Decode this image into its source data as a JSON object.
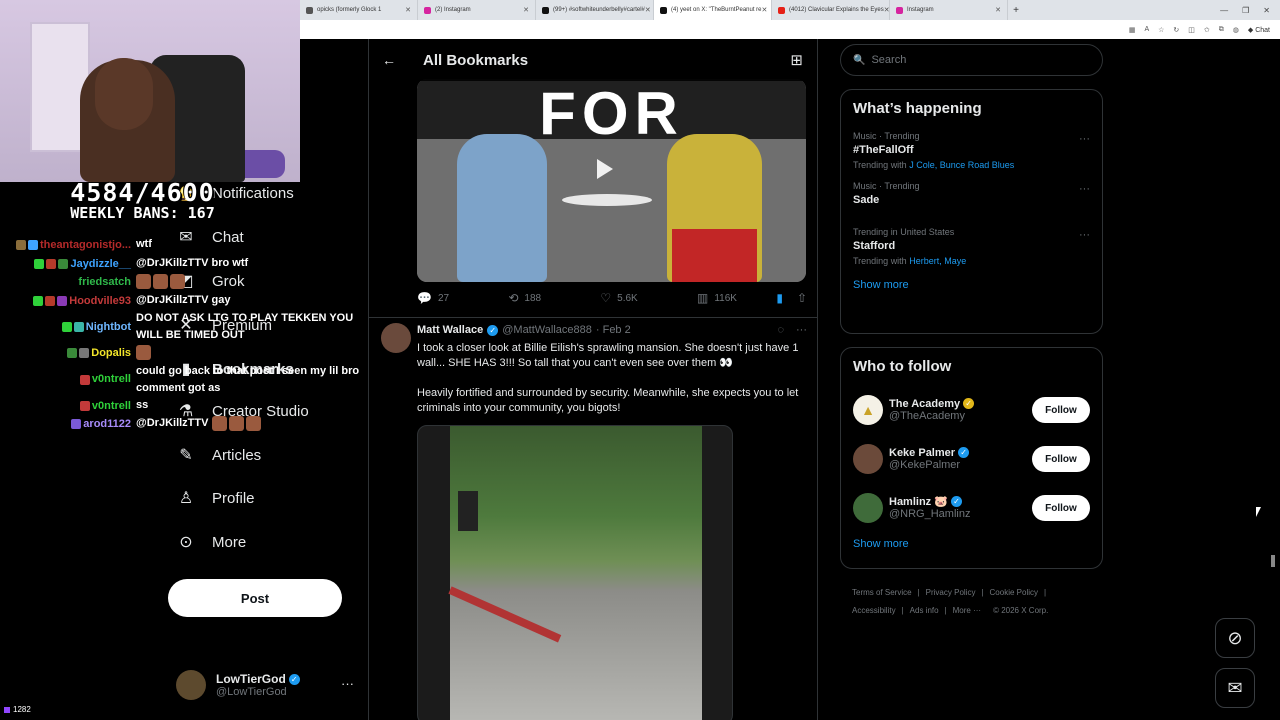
{
  "browser": {
    "tabs": [
      {
        "title": "opicks (formerly Glock 1",
        "color": "#444"
      },
      {
        "title": "(2) Instagram",
        "color": "#d6249f"
      },
      {
        "title": "(99+) #softwhiteunderbelly#cartel#",
        "color": "#111"
      },
      {
        "title": "(4) yeet on X: \"TheBurntPeanut re",
        "color": "#111"
      },
      {
        "title": "(4012) Clavicular Explains the Eyes",
        "color": "#e62117"
      },
      {
        "title": "Instagram",
        "color": "#d6249f"
      }
    ],
    "copilot_label": "Chat"
  },
  "overlay": {
    "counter": "4584/4600",
    "weekly_bans": "WEEKLY BANS: 167",
    "viewers": "1282",
    "chat": [
      {
        "name": "theantagonistjo...",
        "color": "#b52a2a",
        "message": "wtf"
      },
      {
        "name": "Jaydizzle__",
        "color": "#3ea3ff",
        "message": "@DrJKillzTTV bro wtf"
      },
      {
        "name": "friedsatch",
        "color": "#2fb84a",
        "message": ""
      },
      {
        "name": "Hoodville93",
        "color": "#c33a3a",
        "message": "@DrJKillzTTV gay"
      },
      {
        "name": "Nightbot",
        "color": "#6fb7ff",
        "message": "DO NOT ASK LTG TO PLAY TEKKEN YOU WILL BE TIMED OUT"
      },
      {
        "name": "Dopalis",
        "color": "#f2e52a",
        "message": ""
      },
      {
        "name": "v0ntrell",
        "color": "#2fd13a",
        "message": "could go back to that post I seen my lil bro comment got as"
      },
      {
        "name": "v0ntrell",
        "color": "#2fd13a",
        "message": "ss"
      },
      {
        "name": "arod1122",
        "color": "#a78bfa",
        "message": "@DrJKillzTTV"
      }
    ]
  },
  "nav": {
    "items": [
      {
        "label": "Notifications",
        "icon": "bell-icon"
      },
      {
        "label": "Chat",
        "icon": "mail-icon"
      },
      {
        "label": "Grok",
        "icon": "grok-icon"
      },
      {
        "label": "Premium",
        "icon": "x-logo-icon"
      },
      {
        "label": "Bookmarks",
        "icon": "bookmark-icon"
      },
      {
        "label": "Creator Studio",
        "icon": "flask-icon"
      },
      {
        "label": "Articles",
        "icon": "articles-icon"
      },
      {
        "label": "Profile",
        "icon": "person-icon"
      },
      {
        "label": "More",
        "icon": "more-circle-icon"
      }
    ],
    "post_label": "Post",
    "account": {
      "name": "LowTierGod",
      "handle": "@LowTierGod"
    }
  },
  "center": {
    "title": "All Bookmarks",
    "first_tweet_stats": {
      "replies": "27",
      "reposts": "188",
      "likes": "5.6K",
      "views": "116K"
    },
    "tweet": {
      "name": "Matt Wallace",
      "handle": "@MattWallace888",
      "date": "· Feb 2",
      "paragraph1": "I took a closer look at Billie Eilish's sprawling mansion. She doesn't just have 1 wall... SHE HAS 3!!! So tall that you can't even see over them 👀",
      "paragraph2": "Heavily fortified and surrounded by security. Meanwhile, she expects you to let criminals into your community, you bigots!"
    },
    "media1_banner": "FOR"
  },
  "right": {
    "search_placeholder": "Search",
    "happening_title": "What’s happening",
    "trends": [
      {
        "meta": "Music · Trending",
        "name": "#TheFallOff",
        "with_label": "Trending with",
        "with_links": "J Cole, Bunce Road Blues"
      },
      {
        "meta": "Music · Trending",
        "name": "Sade",
        "with_label": "",
        "with_links": ""
      },
      {
        "meta": "Trending in United States",
        "name": "Stafford",
        "with_label": "Trending with",
        "with_links": "Herbert, Maye"
      }
    ],
    "show_more": "Show more",
    "follow_title": "Who to follow",
    "follow": [
      {
        "name": "The Academy",
        "handle": "@TheAcademy",
        "badge": "gold",
        "label": "Follow",
        "avatar_color": "#f4f1e6"
      },
      {
        "name": "Keke Palmer",
        "handle": "@KekePalmer",
        "badge": "blue",
        "label": "Follow",
        "avatar_color": "#6b4a3a"
      },
      {
        "name": "Hamlinz 🐷",
        "handle": "@NRG_Hamlinz",
        "badge": "blue",
        "label": "Follow",
        "avatar_color": "#3f6b3a"
      }
    ],
    "footer": {
      "line1": [
        "Terms of Service",
        "Privacy Policy",
        "Cookie Policy"
      ],
      "line2": [
        "Accessibility",
        "Ads info",
        "More ···",
        "© 2026 X Corp."
      ]
    }
  }
}
